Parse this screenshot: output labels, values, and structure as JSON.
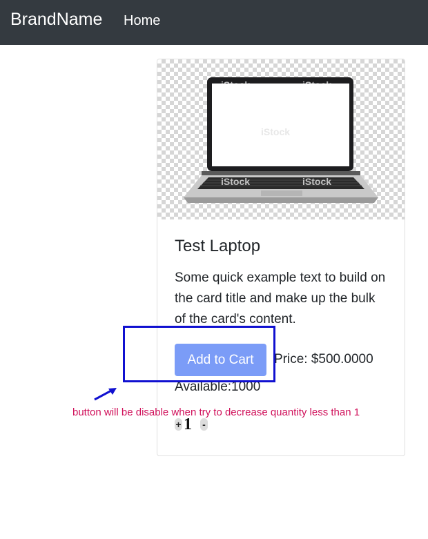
{
  "navbar": {
    "brand": "BrandName",
    "home_label": "Home"
  },
  "product": {
    "image_icon": "laptop-image",
    "title": "Test Laptop",
    "description": "Some quick example text to build on the card title and make up the bulk of the card's content.",
    "add_to_cart_label": "Add to Cart",
    "add_to_cart_state": "disabled",
    "price": "Price: $500.0000",
    "available": "Available:1000"
  },
  "quantity": {
    "increase_label": "+",
    "value": "1",
    "decrease_label": "-"
  },
  "annotation": {
    "text": "button will be disable when try to decrease quantity less than 1"
  },
  "colors": {
    "navbar_bg": "#343a40",
    "button_bg": "#7b9cf7",
    "annotation_box": "#1010d0",
    "annotation_text": "#d0105a"
  }
}
